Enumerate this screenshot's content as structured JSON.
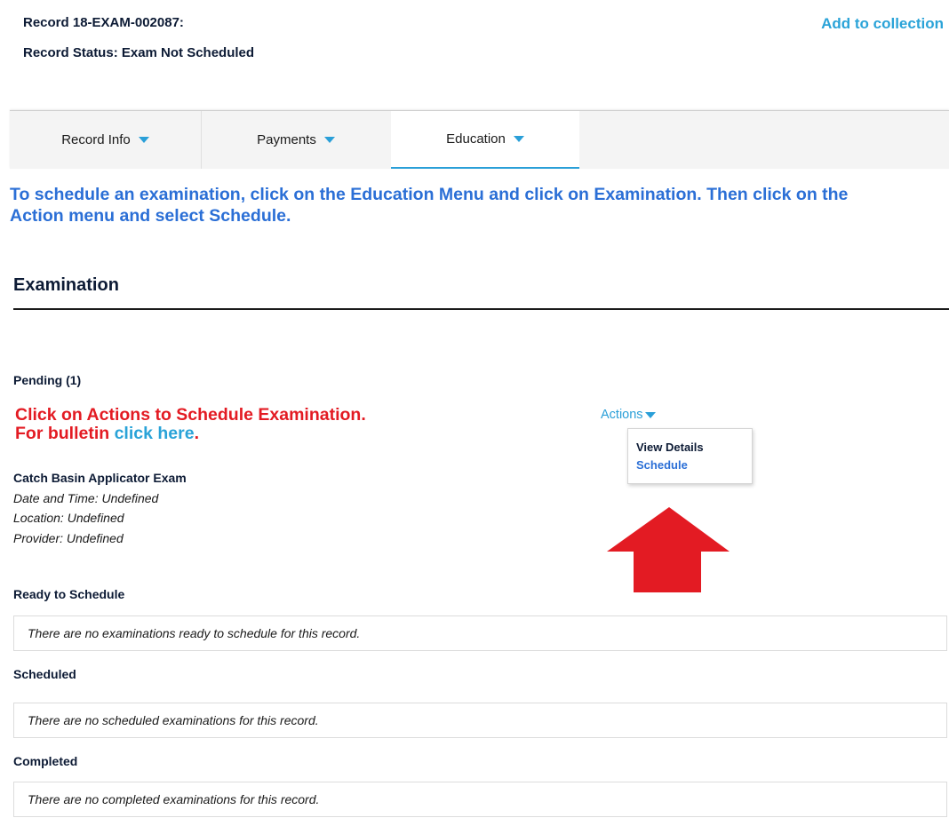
{
  "header": {
    "record_number": "Record 18-EXAM-002087:",
    "record_status": "Record Status: Exam Not Scheduled",
    "add_to_collection": "Add to collection"
  },
  "tabs": [
    {
      "label": "Record Info",
      "active": false
    },
    {
      "label": "Payments",
      "active": false
    },
    {
      "label": "Education",
      "active": true
    }
  ],
  "instruction": {
    "line1": "To schedule an examination, click on the Education Menu and click on Examination. Then click on the",
    "line2": "Action menu and select Schedule."
  },
  "examination": {
    "title": "Examination",
    "pending_title": "Pending (1)",
    "note_line1": "Click on Actions to Schedule Examination.",
    "note_line2_prefix": "For bulletin ",
    "note_link": "click here",
    "note_line2_suffix": ".",
    "exam_name": "Catch Basin Applicator Exam",
    "date_time": "Date and Time: Undefined",
    "location": "Location: Undefined",
    "provider": "Provider: Undefined",
    "actions_label": "Actions",
    "menu": {
      "view_details": "View Details",
      "schedule": "Schedule"
    }
  },
  "sections": {
    "ready_title": "Ready to Schedule",
    "ready_empty": "There are no examinations ready to schedule for this record.",
    "scheduled_title": "Scheduled",
    "scheduled_empty": "There are no scheduled examinations for this record.",
    "completed_title": "Completed",
    "completed_empty": "There are no completed examinations for this record."
  },
  "colors": {
    "link_blue": "#2aa3d8",
    "instruction_blue": "#2b6fd6",
    "alert_red": "#e31b23",
    "navy_text": "#0d1b35"
  },
  "icons": {
    "tab_caret": "caret-down-icon",
    "actions_caret": "caret-down-icon",
    "pointer_arrow": "red-up-arrow-icon"
  }
}
